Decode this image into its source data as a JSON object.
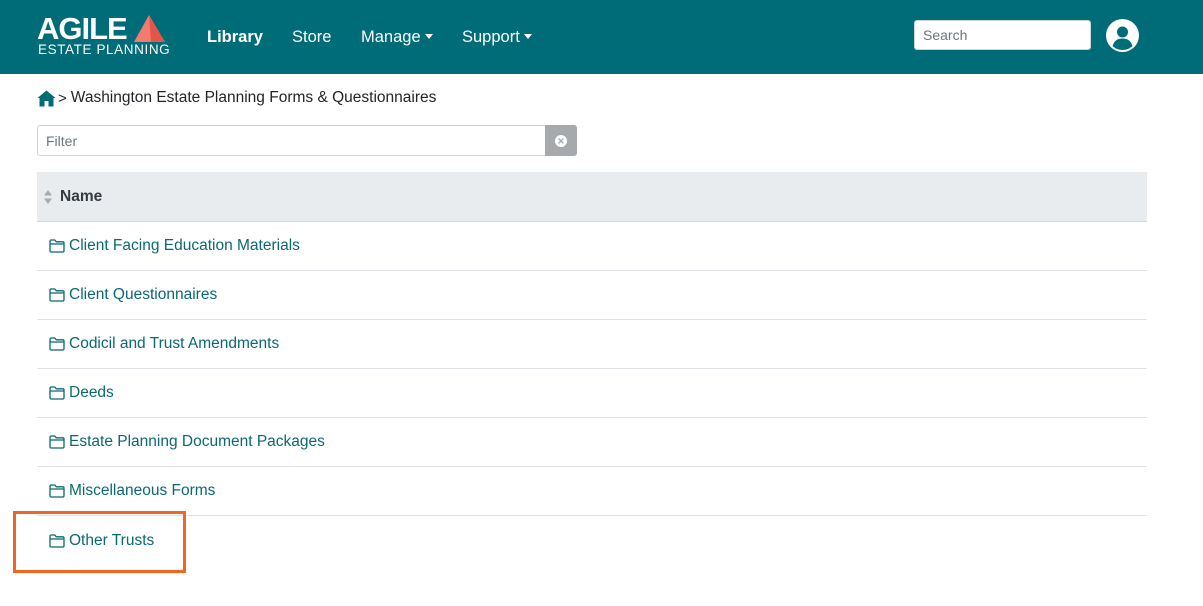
{
  "brand": {
    "logo_main": "AGILE",
    "logo_sub": "ESTATE PLANNING",
    "accent_color": "#006c77",
    "triangle_colors": [
      "#f47c6e",
      "#e6544a"
    ]
  },
  "nav": {
    "library": "Library",
    "store": "Store",
    "manage": "Manage",
    "support": "Support"
  },
  "search": {
    "placeholder": "Search"
  },
  "breadcrumb": {
    "current": "Washington Estate Planning Forms & Questionnaires"
  },
  "filter": {
    "placeholder": "Filter"
  },
  "table": {
    "header": "Name",
    "rows": [
      {
        "label": "Client Facing Education Materials"
      },
      {
        "label": "Client Questionnaires"
      },
      {
        "label": "Codicil and Trust Amendments"
      },
      {
        "label": "Deeds"
      },
      {
        "label": "Estate Planning Document Packages"
      },
      {
        "label": "Miscellaneous Forms"
      },
      {
        "label": "Other Trusts"
      }
    ]
  },
  "icons": {
    "home": "home-icon",
    "folder": "folder-icon",
    "sort": "sort-icon",
    "clear": "clear-icon",
    "user": "user-circle-icon"
  },
  "highlight": {
    "color": "#f26522",
    "target": "Other Trusts"
  }
}
